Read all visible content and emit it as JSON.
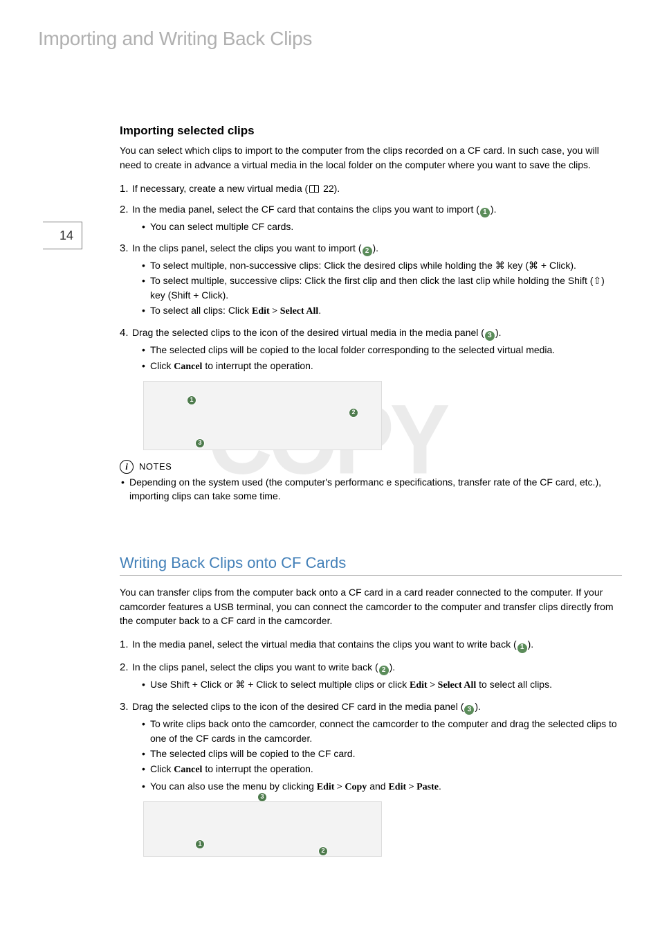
{
  "chapter_title": "Importing and Writing Back Clips",
  "page_number": "14",
  "watermark": "COPY",
  "section1": {
    "heading": "Importing selected clips",
    "intro": "You can select which clips to import to the computer from the clips recorded on a CF card. In such case, you will need to create in advance a virtual media in the local folder on the computer where you want to save the clips.",
    "steps": {
      "s1_lead": "If necessary, create a new virtual media (",
      "s1_ref": " 22).",
      "s2_lead": "In the media panel, select the CF card that contains the clips you want to import (",
      "s2_tail": ").",
      "s2_sub1": "You can select multiple CF cards.",
      "s3_lead": "In the clips panel, select the clips you want to import (",
      "s3_tail": ").",
      "s3_sub1_a": "To select multiple, non-successive clips: Click the desired clips while holding the ",
      "s3_sub1_b": " key (",
      "s3_sub1_c": " + Click).",
      "s3_sub2_a": "To select multiple, successive clips: Click the first clip and then click the last clip while holding the Shift (",
      "s3_sub2_b": ") key (Shift + Click).",
      "s3_sub3_a": "To select all clips: Click ",
      "s3_sub3_b": "Edit > Select All",
      "s3_sub3_c": ".",
      "s4_lead": "Drag the selected clips to the icon of the desired virtual media in the media panel (",
      "s4_tail": ").",
      "s4_sub1": "The selected clips will be copied to the local folder corresponding to the selected virtual media.",
      "s4_sub2_a": "Click ",
      "s4_sub2_b": "Cancel",
      "s4_sub2_c": " to interrupt the operation."
    },
    "notes_label": "NOTES",
    "note1": "Depending on the system used (the computer's performanc e specifications, transfer rate of the CF card, etc.), importing clips can take some time."
  },
  "section2": {
    "heading": "Writing Back Clips onto CF Cards",
    "intro": "You can transfer clips from the computer back onto a CF card in a card reader connected to the computer. If your camcorder features a USB terminal, you can connect the camcorder to the computer and transfer clips directly from the computer back to a CF card in the camcorder.",
    "steps": {
      "s1_lead": "In the media panel, select the virtual media that contains the clips you want to write back (",
      "s1_tail": ").",
      "s2_lead": "In the clips panel, select the clips you want to write back (",
      "s2_tail": ").",
      "s2_sub1_a": "Use Shift + Click or ",
      "s2_sub1_b": " + Click to select multiple clips or click ",
      "s2_sub1_c": "Edit > Select All",
      "s2_sub1_d": " to select all clips.",
      "s3_lead": "Drag the selected clips to the icon of the desired CF card in the media panel (",
      "s3_tail": ").",
      "s3_sub1": "To write clips back onto the camcorder, connect the camcorder to the computer and drag the selected clips to one of the CF cards in the camcorder.",
      "s3_sub2": "The selected clips will be copied to the CF card.",
      "s3_sub3_a": "Click ",
      "s3_sub3_b": "Cancel",
      "s3_sub3_c": " to interrupt the operation.",
      "s3_sub4_a": "You can also use the menu by clicking ",
      "s3_sub4_b": "Edit > Copy",
      "s3_sub4_c": " and ",
      "s3_sub4_d": "Edit > Paste",
      "s3_sub4_e": "."
    }
  },
  "glyphs": {
    "cmd": "⌘",
    "shift": "⇧"
  },
  "callouts": {
    "c1": "1",
    "c2": "2",
    "c3": "3"
  }
}
